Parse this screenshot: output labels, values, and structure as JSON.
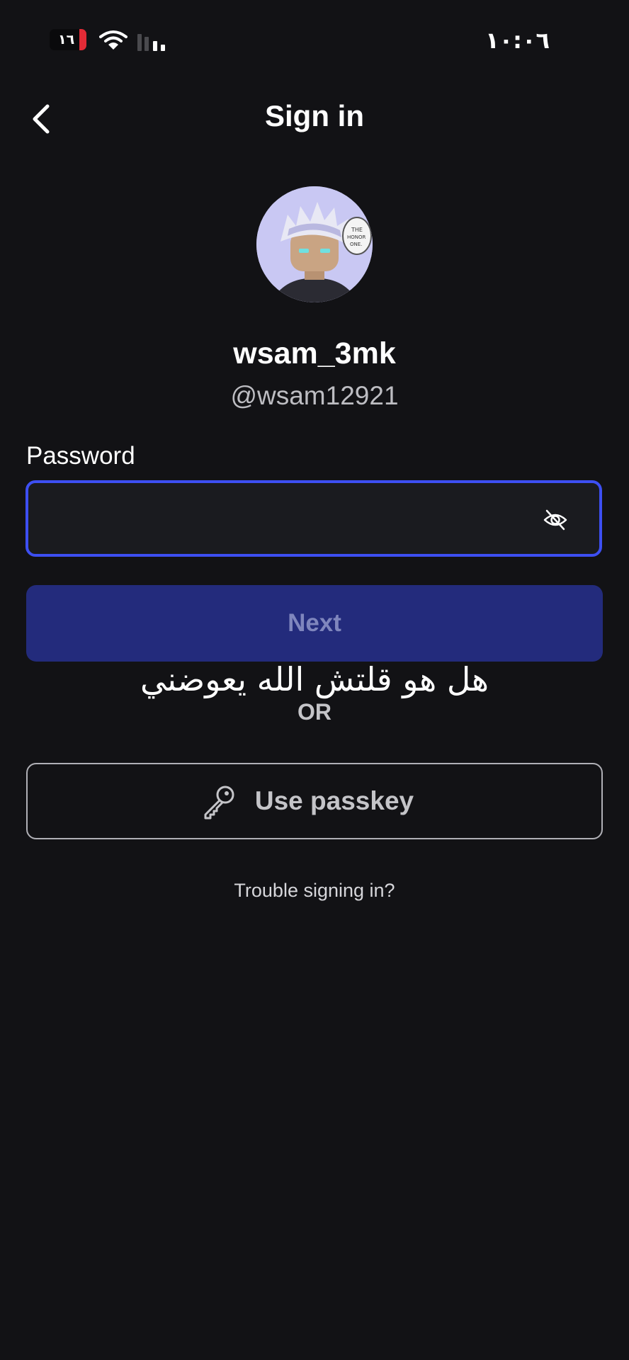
{
  "status_bar": {
    "battery_level": "١٦",
    "time": "١٠:٠٦",
    "battery_color": "#e32b36"
  },
  "header": {
    "back_icon": "chevron-left-icon",
    "title": "Sign in"
  },
  "profile": {
    "avatar": "avatar-image",
    "display_name": "wsam_3mk",
    "username": "@wsam12921"
  },
  "password": {
    "label": "Password",
    "value": "",
    "toggle_icon": "eye-off-icon",
    "focus_color": "#3d4ff2"
  },
  "next_button": {
    "label": "Next",
    "background": "#232b7c"
  },
  "caption_overlay": "هل هو قلتش الله يعوضني",
  "divider": "OR",
  "passkey_button": {
    "icon": "key-icon",
    "label": "Use passkey"
  },
  "trouble_link": "Trouble signing in?"
}
